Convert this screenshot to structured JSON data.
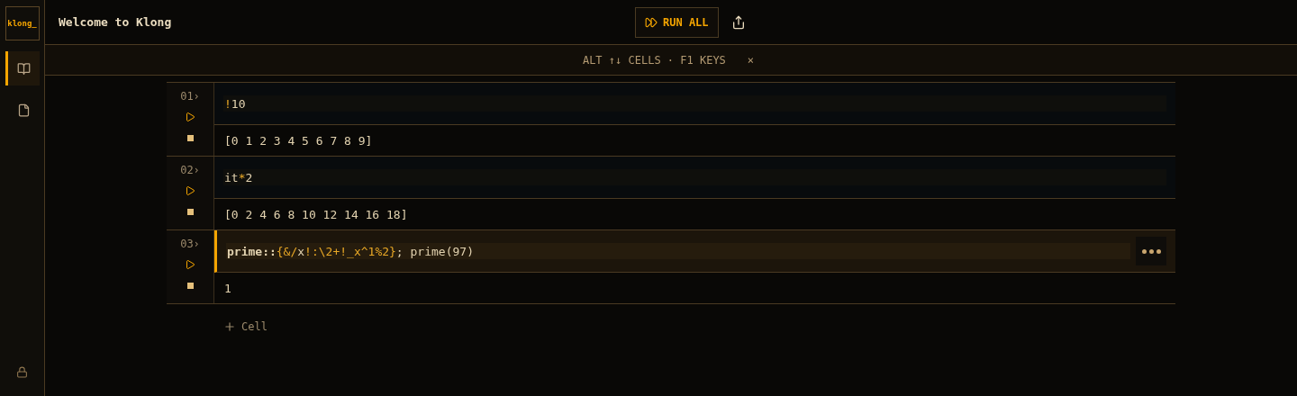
{
  "logo": "klong_",
  "sidebar": {
    "items": [
      {
        "kind": "notebook",
        "selected": true
      },
      {
        "kind": "file",
        "selected": false
      }
    ]
  },
  "header": {
    "title": "Welcome to Klong",
    "run_all": "RUN ALL"
  },
  "hint": {
    "text": "ALT ↑↓ CELLS · F1 KEYS",
    "close": "×"
  },
  "cells": [
    {
      "number": "01›",
      "selected": false,
      "code": [
        {
          "text": "!",
          "kind": "op"
        },
        {
          "text": "10",
          "kind": "plain"
        }
      ],
      "output": "[0 1 2 3 4 5 6 7 8 9]"
    },
    {
      "number": "02›",
      "selected": false,
      "code": [
        {
          "text": "it",
          "kind": "plain"
        },
        {
          "text": "*",
          "kind": "op"
        },
        {
          "text": "2",
          "kind": "plain"
        }
      ],
      "output": "[0 2 4 6 8 10 12 14 16 18]"
    },
    {
      "number": "03›",
      "selected": true,
      "code": [
        {
          "text": "prime::",
          "kind": "name"
        },
        {
          "text": "{&/",
          "kind": "op"
        },
        {
          "text": "x",
          "kind": "plain"
        },
        {
          "text": "!:\\2+!_x^1%2}",
          "kind": "op"
        },
        {
          "text": "; prime(97)",
          "kind": "plain"
        }
      ],
      "output": "1"
    }
  ],
  "add_cell": "Cell"
}
